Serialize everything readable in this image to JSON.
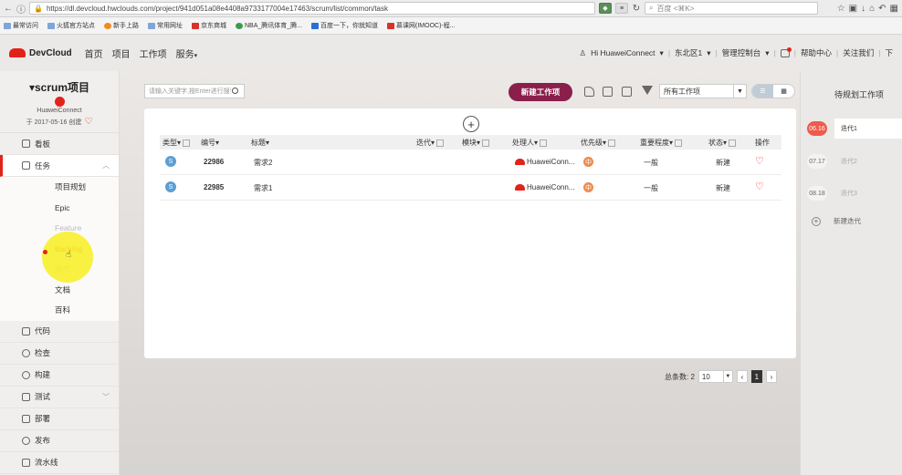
{
  "browser": {
    "url": "https://dl.devcloud.hwclouds.com/project/941d051a08e4408a9733177004e17463/scrum/list/common/task",
    "search_placeholder": "百度 <⌘K>",
    "bookmarks": [
      "最常访问",
      "火狐官方站点",
      "新手上路",
      "常用网址",
      "京东商城",
      "NBA_腾讯体育_腾...",
      "百度一下，你就知道",
      "慕课网(IMOOC)-程..."
    ]
  },
  "header": {
    "logo_text": "DevCloud",
    "nav": [
      "首页",
      "项目",
      "工作项",
      "服务"
    ],
    "user": "Hi HuaweiConnect",
    "region": "东北区1",
    "console": "管理控制台",
    "help": "帮助中心",
    "follow": "关注我们",
    "more": "下"
  },
  "sidebar": {
    "project_title": "scrum项目",
    "owner": "HuaweiConnect",
    "created": "于 2017-05-16 创建",
    "items": [
      {
        "label": "看板"
      },
      {
        "label": "任务"
      },
      {
        "label": "代码"
      },
      {
        "label": "检查"
      },
      {
        "label": "构建"
      },
      {
        "label": "测试"
      },
      {
        "label": "部署"
      },
      {
        "label": "发布"
      },
      {
        "label": "流水线"
      }
    ],
    "sub_items": [
      "项目规划",
      "Epic",
      "Feature",
      "Backlog",
      "迭代",
      "文档",
      "百科"
    ]
  },
  "toolbar": {
    "search_placeholder": "请输入关键字,按Enter进行搜索",
    "new_button": "新建工作项",
    "filter_value": "所有工作项"
  },
  "table": {
    "headers": [
      "类型",
      "编号",
      "标题",
      "迭代",
      "模块",
      "处理人",
      "优先级",
      "重要程度",
      "状态",
      "操作"
    ],
    "rows": [
      {
        "type": "S",
        "id": "22986",
        "title": "需求2",
        "assignee": "HuaweiConn...",
        "priority": "中",
        "importance": "一般",
        "status": "新建"
      },
      {
        "type": "S",
        "id": "22985",
        "title": "需求1",
        "assignee": "HuaweiConn...",
        "priority": "中",
        "importance": "一般",
        "status": "新建"
      }
    ]
  },
  "pager": {
    "total_label": "总条数: 2",
    "page_size": "10",
    "current_page": "1"
  },
  "plan": {
    "title": "待规划工作项",
    "iterations": [
      {
        "date": "06.16",
        "name": "迭代1"
      },
      {
        "date": "07.17",
        "name": "迭代2"
      },
      {
        "date": "08.18",
        "name": "迭代3"
      }
    ],
    "add_label": "新建迭代"
  }
}
